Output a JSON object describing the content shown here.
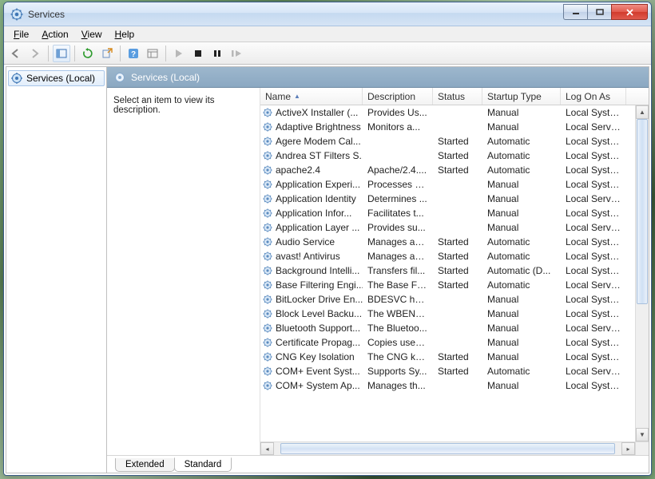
{
  "window": {
    "title": "Services"
  },
  "menu": {
    "file": "File",
    "action": "Action",
    "view": "View",
    "help": "Help"
  },
  "tree": {
    "root": "Services (Local)"
  },
  "pane": {
    "title": "Services (Local)"
  },
  "descPanel": {
    "prompt": "Select an item to view its description."
  },
  "columns": {
    "name": "Name",
    "description": "Description",
    "status": "Status",
    "startup": "Startup Type",
    "logon": "Log On As"
  },
  "tabs": {
    "extended": "Extended",
    "standard": "Standard"
  },
  "services": [
    {
      "name": "ActiveX Installer (...",
      "desc": "Provides Us...",
      "status": "",
      "startup": "Manual",
      "logon": "Local Syste..."
    },
    {
      "name": "Adaptive Brightness",
      "desc": "Monitors a...",
      "status": "",
      "startup": "Manual",
      "logon": "Local Service"
    },
    {
      "name": "Agere Modem Cal...",
      "desc": "",
      "status": "Started",
      "startup": "Automatic",
      "logon": "Local Syste..."
    },
    {
      "name": "Andrea ST Filters S...",
      "desc": "",
      "status": "Started",
      "startup": "Automatic",
      "logon": "Local Syste..."
    },
    {
      "name": "apache2.4",
      "desc": "Apache/2.4....",
      "status": "Started",
      "startup": "Automatic",
      "logon": "Local Syste...",
      "highlight": true
    },
    {
      "name": "Application Experi...",
      "desc": "Processes a...",
      "status": "",
      "startup": "Manual",
      "logon": "Local Syste..."
    },
    {
      "name": "Application Identity",
      "desc": "Determines ...",
      "status": "",
      "startup": "Manual",
      "logon": "Local Service"
    },
    {
      "name": "Application Infor...",
      "desc": "Facilitates t...",
      "status": "",
      "startup": "Manual",
      "logon": "Local Syste..."
    },
    {
      "name": "Application Layer ...",
      "desc": "Provides su...",
      "status": "",
      "startup": "Manual",
      "logon": "Local Service"
    },
    {
      "name": "Audio Service",
      "desc": "Manages au...",
      "status": "Started",
      "startup": "Automatic",
      "logon": "Local Syste..."
    },
    {
      "name": "avast! Antivirus",
      "desc": "Manages an...",
      "status": "Started",
      "startup": "Automatic",
      "logon": "Local Syste..."
    },
    {
      "name": "Background Intelli...",
      "desc": "Transfers fil...",
      "status": "Started",
      "startup": "Automatic (D...",
      "logon": "Local Syste..."
    },
    {
      "name": "Base Filtering Engi...",
      "desc": "The Base Fil...",
      "status": "Started",
      "startup": "Automatic",
      "logon": "Local Service"
    },
    {
      "name": "BitLocker Drive En...",
      "desc": "BDESVC hos...",
      "status": "",
      "startup": "Manual",
      "logon": "Local Syste..."
    },
    {
      "name": "Block Level Backu...",
      "desc": "The WBENG...",
      "status": "",
      "startup": "Manual",
      "logon": "Local Syste..."
    },
    {
      "name": "Bluetooth Support...",
      "desc": "The Bluetoo...",
      "status": "",
      "startup": "Manual",
      "logon": "Local Service"
    },
    {
      "name": "Certificate Propag...",
      "desc": "Copies user ...",
      "status": "",
      "startup": "Manual",
      "logon": "Local Syste..."
    },
    {
      "name": "CNG Key Isolation",
      "desc": "The CNG ke...",
      "status": "Started",
      "startup": "Manual",
      "logon": "Local Syste..."
    },
    {
      "name": "COM+ Event Syst...",
      "desc": "Supports Sy...",
      "status": "Started",
      "startup": "Automatic",
      "logon": "Local Service"
    },
    {
      "name": "COM+ System Ap...",
      "desc": "Manages th...",
      "status": "",
      "startup": "Manual",
      "logon": "Local Syste..."
    }
  ]
}
